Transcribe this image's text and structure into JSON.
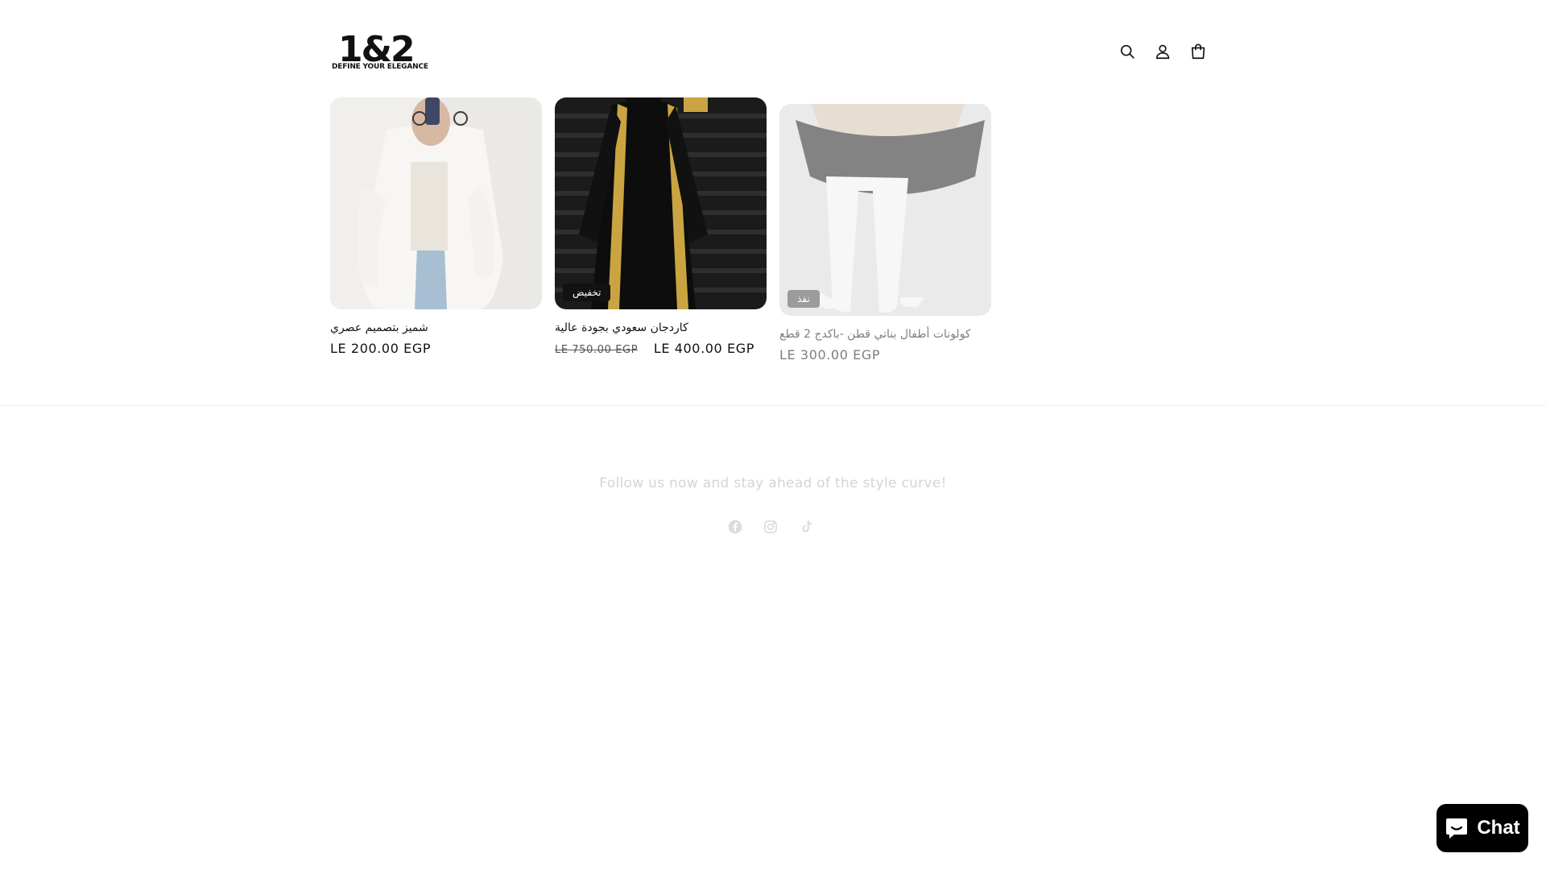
{
  "header": {
    "logo_main": "1&2",
    "logo_tagline": "DEFINE YOUR ELEGANCE",
    "icons": [
      "search-icon",
      "account-icon",
      "cart-icon"
    ]
  },
  "products": [
    {
      "title": "شميز بتصميم عصري",
      "price": "LE 200.00 EGP",
      "badge": "",
      "image": "woman in white oversized shirt taking mirror selfie"
    },
    {
      "title": "كاردجان سعودي بجودة عالية",
      "compare_price": "LE 750.00 EGP",
      "price": "LE 400.00 EGP",
      "badge": "تخفيض",
      "image": "woman in black abaya with gold trim"
    },
    {
      "title": "كولونات أطفال بناتي قطن -باكدج 2 قطع",
      "price": "LE 300.00 EGP",
      "badge": "نفذ",
      "image": "child wearing white tights and grey skirt"
    }
  ],
  "footer": {
    "follow_text": "Follow us now and stay ahead of the style curve!",
    "social": [
      "facebook-icon",
      "instagram-icon",
      "tiktok-icon"
    ]
  },
  "chat": {
    "label": "Chat"
  },
  "colors": {
    "text": "#121212",
    "badge": "#121212",
    "soldout_badge": "#4a4a4a",
    "chat_bg": "#000000"
  }
}
